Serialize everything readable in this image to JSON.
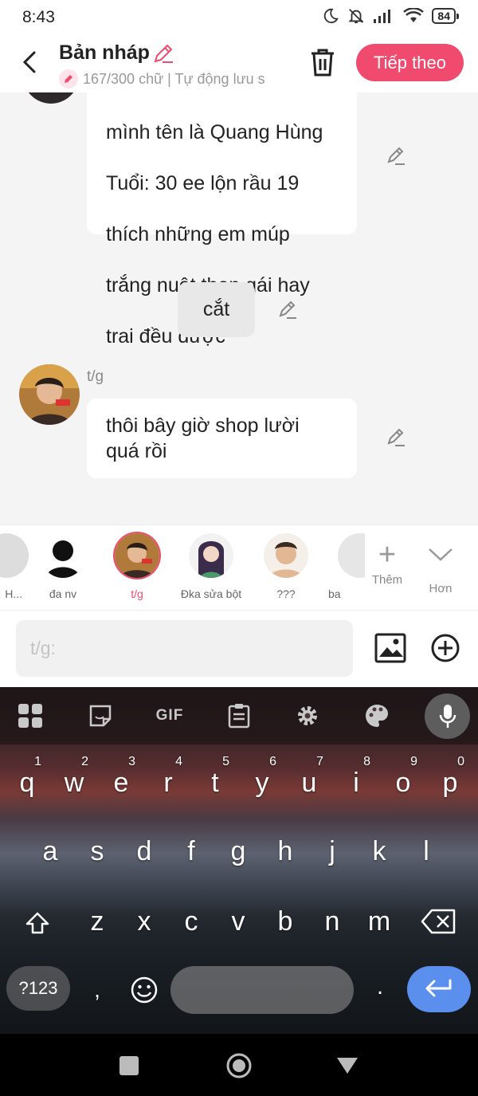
{
  "status_bar": {
    "time": "8:43",
    "battery": "84"
  },
  "header": {
    "title": "Bản nháp",
    "subtitle": "167/300 chữ | Tự động lưu s",
    "next_label": "Tiếp theo"
  },
  "chat": {
    "message1_lines": [
      "mình tên là Quang Hùng",
      "Tuổi: 30 ee lộn rầu 19",
      "thích những em múp",
      "trắng nuột thon  gái hay",
      "trai đều được"
    ],
    "narration": "cắt",
    "message2_sender": "t/g",
    "message2_text": "thôi bây giờ shop lười quá rồi"
  },
  "characters": [
    {
      "name": "H..."
    },
    {
      "name": "đa nv"
    },
    {
      "name": "t/g"
    },
    {
      "name": "Đka sửa bột"
    },
    {
      "name": "???"
    },
    {
      "name": "ba"
    }
  ],
  "tools": {
    "add_label": "Thêm",
    "more_label": "Hơn"
  },
  "input": {
    "placeholder": "t/g:"
  },
  "keyboard": {
    "gif_label": "GIF",
    "row1": [
      "q",
      "w",
      "e",
      "r",
      "t",
      "y",
      "u",
      "i",
      "o",
      "p"
    ],
    "row1_hints": [
      "1",
      "2",
      "3",
      "4",
      "5",
      "6",
      "7",
      "8",
      "9",
      "0"
    ],
    "row2": [
      "a",
      "s",
      "d",
      "f",
      "g",
      "h",
      "j",
      "k",
      "l"
    ],
    "row3": [
      "z",
      "x",
      "c",
      "v",
      "b",
      "n",
      "m"
    ],
    "symbols_label": "?123",
    "comma": ",",
    "period": "."
  },
  "colors": {
    "accent": "#f04b6e",
    "enter_key": "#5b8fee"
  }
}
